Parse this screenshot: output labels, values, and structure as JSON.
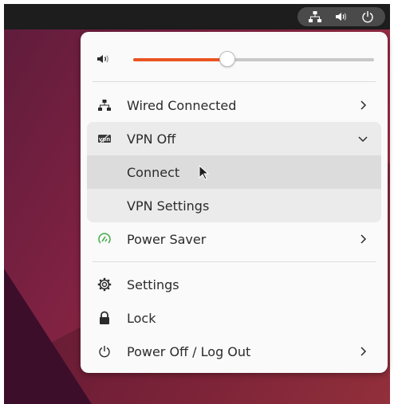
{
  "quick_settings": {
    "volume": {
      "level": 0.39
    },
    "wired": {
      "label": "Wired Connected"
    },
    "vpn": {
      "label": "VPN Off",
      "items": [
        {
          "label": "Connect"
        },
        {
          "label": "VPN Settings"
        }
      ]
    },
    "power_mode": {
      "label": "Power Saver"
    },
    "settings": {
      "label": "Settings"
    },
    "lock": {
      "label": "Lock"
    },
    "power_off": {
      "label": "Power Off / Log Out"
    }
  },
  "colors": {
    "accent": "#e95420",
    "power_saver_icon": "#4caf50"
  },
  "icons": [
    "network-wired-icon",
    "volume-icon",
    "power-icon",
    "vpn-icon",
    "power-saver-icon",
    "gear-icon",
    "lock-icon",
    "chevron-right-icon",
    "chevron-down-icon"
  ]
}
